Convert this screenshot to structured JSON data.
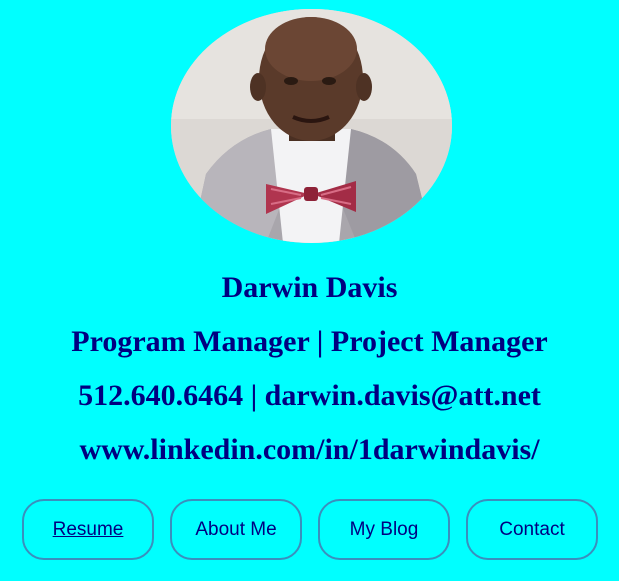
{
  "profile": {
    "name": "Darwin Davis",
    "title": "Program Manager | Project Manager",
    "contact_line": "512.640.6464 | darwin.davis@att.net",
    "linkedin": "www.linkedin.com/in/1darwindavis/"
  },
  "nav": {
    "buttons": [
      {
        "label": "Resume"
      },
      {
        "label": "About Me"
      },
      {
        "label": "My Blog"
      },
      {
        "label": "Contact"
      }
    ]
  },
  "colors": {
    "background": "#00ffff",
    "text": "#000080",
    "button_border": "#3a8fbd"
  }
}
